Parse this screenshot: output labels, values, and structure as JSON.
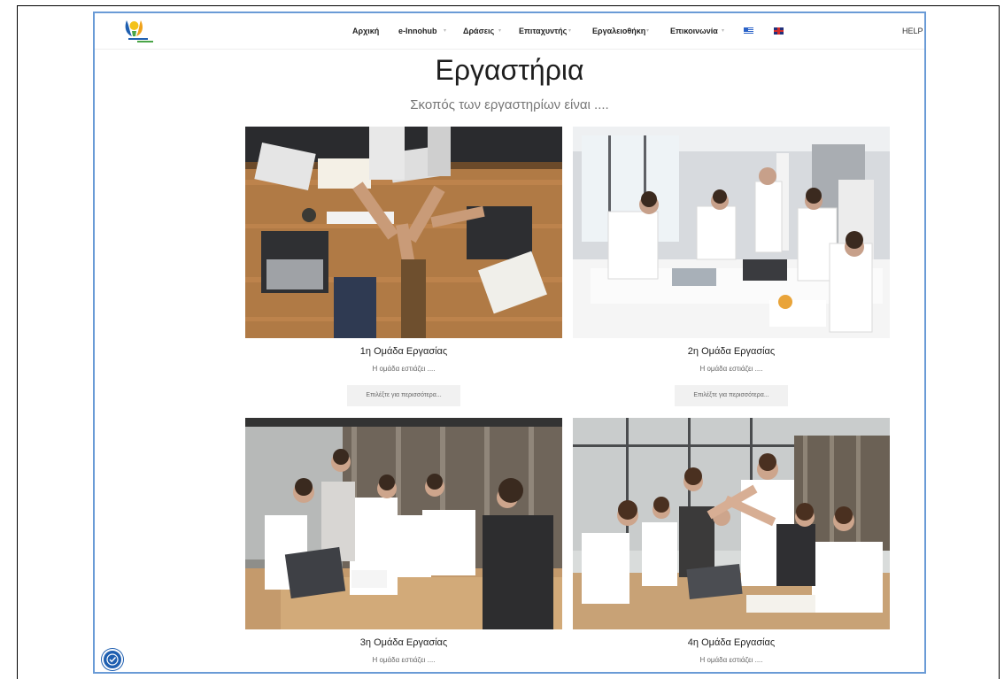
{
  "nav": {
    "items": [
      {
        "label": "Αρχική"
      },
      {
        "label": "e-Innohub"
      },
      {
        "label": "Δράσεις"
      },
      {
        "label": "Επιταχυντής"
      },
      {
        "label": "Εργαλειοθήκη"
      },
      {
        "label": "Επικοινωνία"
      }
    ],
    "help_label": "HELP D",
    "languages": [
      "greek-flag-icon",
      "uk-flag-icon"
    ]
  },
  "page": {
    "title": "Εργαστήρια",
    "subtitle": "Σκοπός των εργαστηρίων είναι  ...."
  },
  "cards": [
    {
      "title": "1η Ομάδα Εργασίας",
      "desc": "Η ομάδα εστιάζει ....",
      "button": "Επιλέξτε για περισσότερα..."
    },
    {
      "title": "2η Ομάδα Εργασίας",
      "desc": "Η ομάδα εστιάζει ....",
      "button": "Επιλέξτε για περισσότερα..."
    },
    {
      "title": "3η Ομάδα Εργασίας",
      "desc": "Η ομάδα εστιάζει ...."
    },
    {
      "title": "4η Ομάδα Εργασίας",
      "desc": "Η ομάδα εστιάζει ...."
    }
  ],
  "colors": {
    "frame_border": "#6a9bd6",
    "accessibility": "#1f5fb0"
  },
  "icons": {
    "accessibility": "accessibility-icon"
  }
}
